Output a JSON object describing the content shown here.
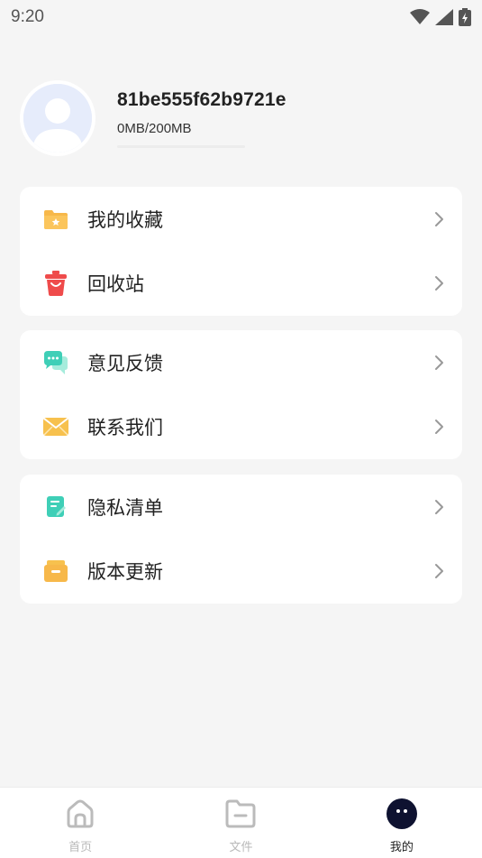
{
  "status_bar": {
    "time": "9:20",
    "icons": [
      "wifi-icon",
      "signal-icon",
      "battery-icon"
    ]
  },
  "profile": {
    "username": "81be555f62b9721e",
    "storage_text": "0MB/200MB",
    "storage_used_fraction": 0.0,
    "avatar_icon": "default-avatar-icon"
  },
  "menu_groups": [
    {
      "items": [
        {
          "label": "我的收藏",
          "icon": "favorites-folder-icon"
        },
        {
          "label": "回收站",
          "icon": "trash-icon"
        }
      ]
    },
    {
      "items": [
        {
          "label": "意见反馈",
          "icon": "feedback-chat-icon"
        },
        {
          "label": "联系我们",
          "icon": "mail-icon"
        }
      ]
    },
    {
      "items": [
        {
          "label": "隐私清单",
          "icon": "privacy-list-icon"
        },
        {
          "label": "版本更新",
          "icon": "version-update-icon"
        }
      ]
    }
  ],
  "tabbar": {
    "tabs": [
      {
        "label": "首页",
        "icon": "home-icon",
        "active": false
      },
      {
        "label": "文件",
        "icon": "folder-icon",
        "active": false
      },
      {
        "label": "我的",
        "icon": "profile-face-icon",
        "active": true
      }
    ]
  },
  "colors": {
    "background": "#f5f5f5",
    "card": "#ffffff",
    "text_primary": "#222222",
    "tab_inactive": "#b9b9b9",
    "folder_orange": "#f7b84a",
    "trash_red": "#ef4b4b",
    "feedback_teal": "#3fcfb7",
    "mail_yellow": "#f7c14e"
  }
}
